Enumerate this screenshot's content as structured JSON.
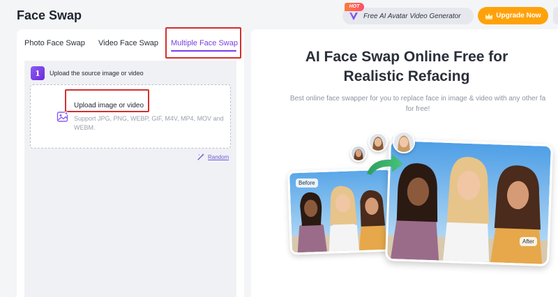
{
  "header": {
    "title": "Face Swap",
    "promo": {
      "badge": "HOT",
      "label": "Free AI Avatar Video Generator",
      "icon": "v-logo-icon"
    },
    "upgrade": {
      "label": "Upgrade Now",
      "icon": "crown-icon"
    }
  },
  "tabs": [
    {
      "label": "Photo Face Swap",
      "active": false
    },
    {
      "label": "Video Face Swap",
      "active": false
    },
    {
      "label": "Multiple Face Swap",
      "active": true
    }
  ],
  "step": {
    "number": "1",
    "label": "Upload the source image or video"
  },
  "upload": {
    "title": "Upload image or video",
    "hint": "Support JPG, PNG, WEBP, GIF, M4V, MP4, MOV and WEBM.",
    "icon": "image-icon"
  },
  "random": {
    "label": "Random",
    "icon": "magic-wand-icon"
  },
  "hero": {
    "title": "AI Face Swap Online Free for Realistic Refacing",
    "subtitle_line1": "Best online face swapper for you to replace face in image & video with any other fa",
    "subtitle_line2": "for free!",
    "before_label": "Before",
    "after_label": "After"
  },
  "colors": {
    "accent": "#7a3fe4",
    "upgrade": "#ffa20a",
    "highlight": "#d32f2f"
  }
}
